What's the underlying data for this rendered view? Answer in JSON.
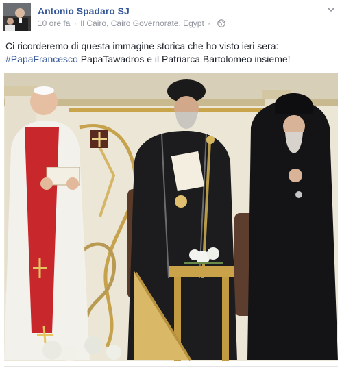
{
  "post": {
    "author": "Antonio Spadaro SJ",
    "time": "10 ore fa",
    "separator": "·",
    "location": "Il Cairo, Cairo Governorate, Egypt",
    "audience_icon": "globe-icon",
    "text_line1": "Ci ricorderemo di questa immagine storica che ho visto ieri sera:",
    "hashtag": "#PapaFrancesco",
    "text_line2_rest": " PapaTawadros e il Patriarca Bartolomeo insieme!"
  },
  "colors": {
    "link": "#365899",
    "meta": "#90949c",
    "text": "#1d2129"
  }
}
